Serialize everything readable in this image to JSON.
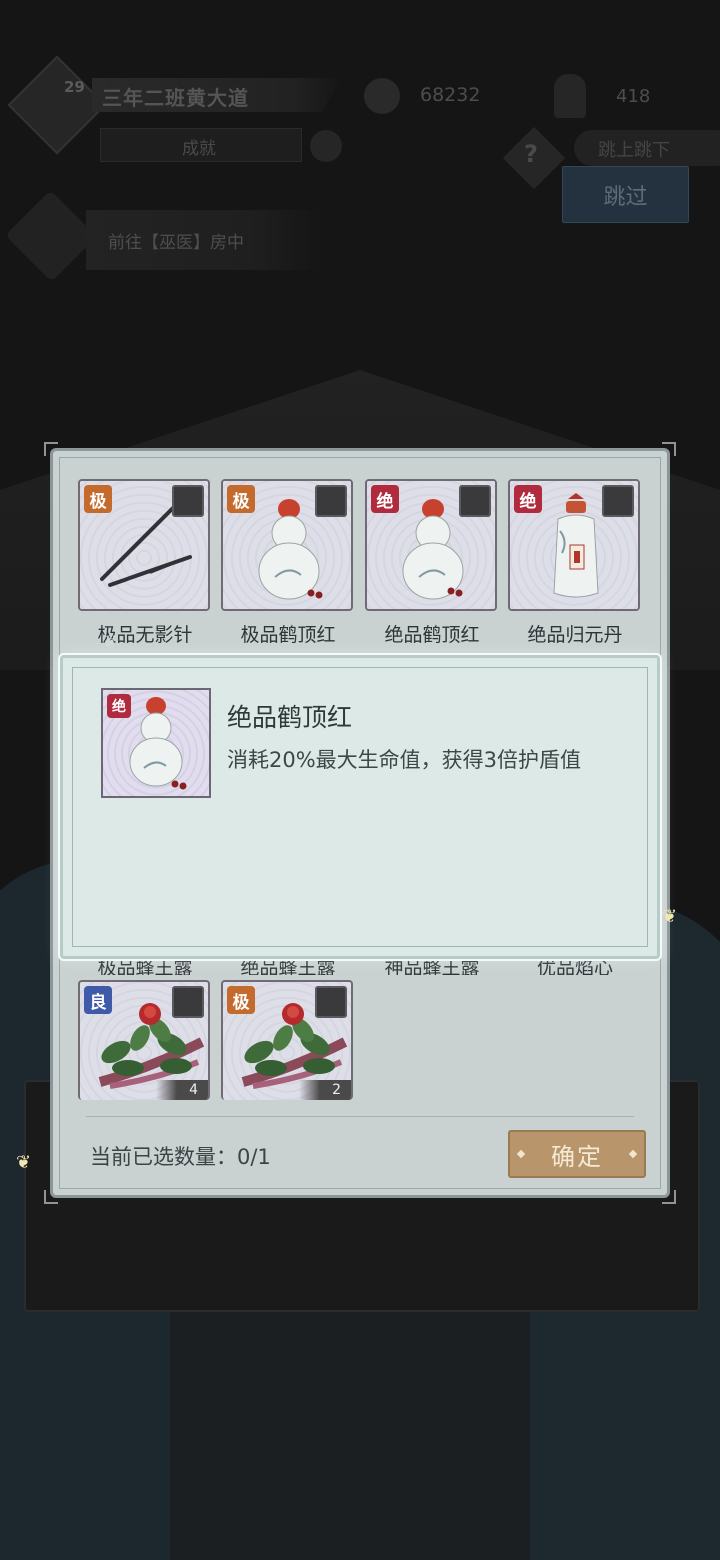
{
  "hud": {
    "level": "29",
    "player_name": "三年二班黄大道",
    "sub_label": "成就",
    "coins": "68232",
    "followers": "418",
    "help_icon": "?",
    "tab_label": "跳上跳下",
    "skip_label": "跳过",
    "quest_text": "前往【巫医】房中"
  },
  "items": [
    {
      "grade": "极",
      "grade_type": "ji",
      "name": "极品无影针",
      "icon": "needles-icon"
    },
    {
      "grade": "极",
      "grade_type": "ji",
      "name": "极品鹤顶红",
      "icon": "gourd-icon"
    },
    {
      "grade": "绝",
      "grade_type": "jue",
      "name": "绝品鹤顶红",
      "icon": "gourd-icon"
    },
    {
      "grade": "绝",
      "grade_type": "jue",
      "name": "绝品归元丹",
      "icon": "bottle-icon"
    }
  ],
  "hidden_row_labels": [
    "极品蜂王露",
    "绝品蜂王露",
    "神品蜂王露",
    "优品焰心"
  ],
  "bottom_items": [
    {
      "grade": "良",
      "grade_type": "liang",
      "count": "4",
      "icon": "herb-icon"
    },
    {
      "grade": "极",
      "grade_type": "ji",
      "count": "2",
      "icon": "herb-icon"
    }
  ],
  "tooltip": {
    "grade": "绝",
    "title": "绝品鹤顶红",
    "description": "消耗20%最大生命值，获得3倍护盾值"
  },
  "footer": {
    "selected_label": "当前已选数量：0/1",
    "confirm_label": "确定"
  },
  "colors": {
    "panel": "#c9d1d1",
    "tooltip": "#dce9e6",
    "grade_ji": "#c46a2c",
    "grade_jue": "#b02b3d",
    "grade_liang": "#3e5aa8",
    "confirm": "#b8956a"
  }
}
